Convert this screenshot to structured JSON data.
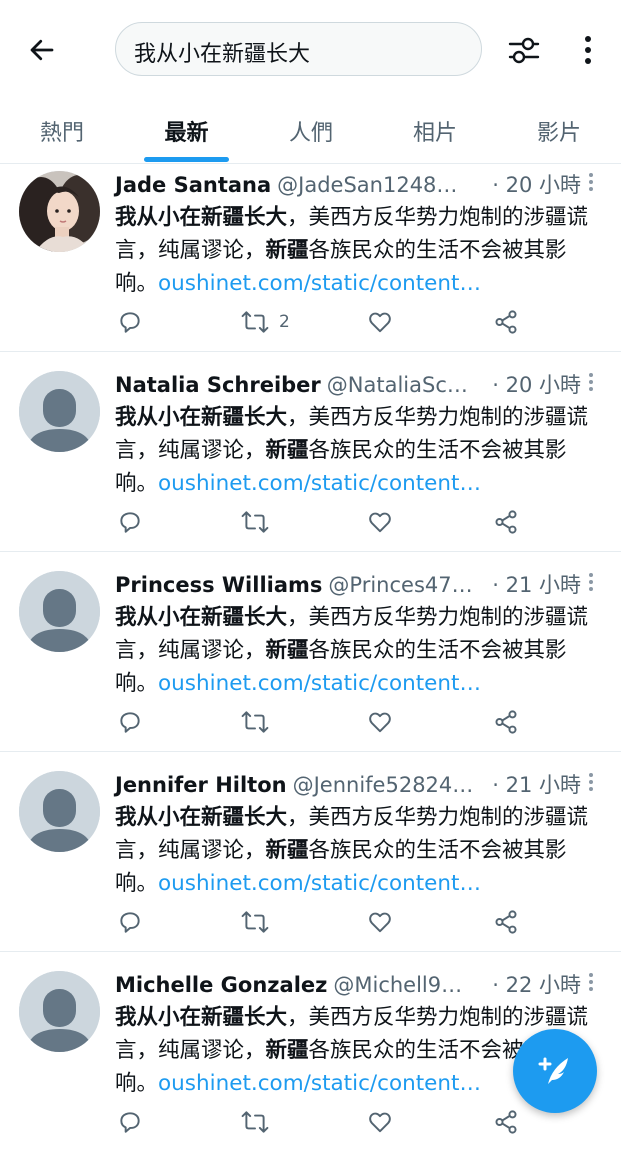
{
  "search": {
    "query": "我从小在新疆长大"
  },
  "tabs": [
    {
      "label": "熱門",
      "active": false
    },
    {
      "label": "最新",
      "active": true
    },
    {
      "label": "人們",
      "active": false
    },
    {
      "label": "相片",
      "active": false
    },
    {
      "label": "影片",
      "active": false
    }
  ],
  "colors": {
    "accent": "#1d9bf0",
    "text": "#0f1419",
    "muted": "#536471",
    "divider": "#e6ecf0"
  },
  "tweet_text": {
    "bold_phrase": "我从小在新疆长大",
    "part1": "，美西方反华势力炮制的涉疆谎言，纯属谬论，",
    "bold_word": "新疆",
    "part2": "各族民众的生活不会被其影响。",
    "link": "oushinet.com/static/content…"
  },
  "tweets": [
    {
      "name": "Jade Santana",
      "handle": "@JadeSan1248…",
      "time": "· 20 小時",
      "avatar": "photo",
      "retweets": "2"
    },
    {
      "name": "Natalia Schreiber",
      "handle": "@NataliaSc…",
      "time": "· 20 小時",
      "avatar": "default-avatar",
      "retweets": ""
    },
    {
      "name": "Princess Williams",
      "handle": "@Princes47…",
      "time": "· 21 小時",
      "avatar": "default-avatar",
      "retweets": ""
    },
    {
      "name": "Jennifer Hilton",
      "handle": "@Jennife52824…",
      "time": "· 21 小時",
      "avatar": "default-avatar",
      "retweets": ""
    },
    {
      "name": "Michelle Gonzalez",
      "handle": "@Michell9…",
      "time": "· 22 小時",
      "avatar": "default-avatar",
      "retweets": ""
    }
  ],
  "icons": {
    "back": "arrow-left-icon",
    "filter": "sliders-icon",
    "more": "more-vertical-icon",
    "reply": "reply-icon",
    "retweet": "retweet-icon",
    "like": "heart-icon",
    "share": "share-icon",
    "compose": "compose-tweet-icon"
  }
}
